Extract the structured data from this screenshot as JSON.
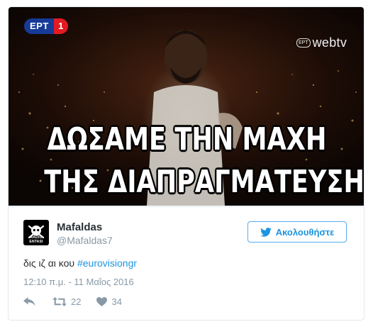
{
  "media": {
    "channel_logo": "ΕΡΤ",
    "channel_number": "1",
    "webtv_small": "ΕΡΤ",
    "webtv_big": "webtv",
    "caption_line_1": "ΔΩΣΑΜΕ ΤΗΝ ΜΑΧΗ",
    "caption_line_2": "ΤΗΣ ΔΙΑΠΡΑΓΜΑΤΕΥΣΗΣ"
  },
  "author": {
    "display_name": "Mafaldas",
    "handle": "@Mafaldas7",
    "avatar_text": "RADIO ENTASI"
  },
  "follow_button": {
    "label": "Ακολουθήστε",
    "icon": "twitter-bird-icon"
  },
  "tweet": {
    "text": "δις ιζ αι κου ",
    "hashtag": "#eurovisiongr",
    "timestamp": "12:10 π.μ. - 11 Μαΐος 2016"
  },
  "actions": {
    "reply_icon": "reply-icon",
    "retweet_icon": "retweet-icon",
    "retweet_count": "22",
    "like_icon": "heart-icon",
    "like_count": "34"
  },
  "colors": {
    "link": "#1b95e0",
    "muted": "#8899a6",
    "ert_blue": "#163a96",
    "ert_red": "#e21b23"
  }
}
